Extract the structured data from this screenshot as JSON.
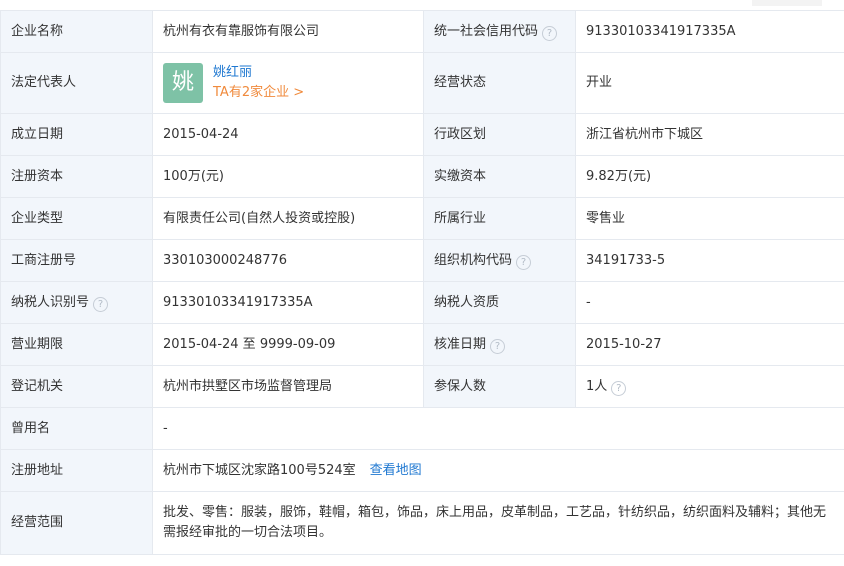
{
  "rows": [
    {
      "l1": "企业名称",
      "v1": "杭州有衣有靠服饰有限公司",
      "l2": "统一社会信用代码",
      "v2": "91330103341917335A"
    },
    {
      "l1": "法定代表人",
      "l2": "经营状态",
      "v2": "开业"
    },
    {
      "l1": "成立日期",
      "v1": "2015-04-24",
      "l2": "行政区划",
      "v2": "浙江省杭州市下城区"
    },
    {
      "l1": "注册资本",
      "v1": "100万(元)",
      "l2": "实缴资本",
      "v2": "9.82万(元)"
    },
    {
      "l1": "企业类型",
      "v1": "有限责任公司(自然人投资或控股)",
      "l2": "所属行业",
      "v2": "零售业"
    },
    {
      "l1": "工商注册号",
      "v1": "330103000248776",
      "l2": "组织机构代码",
      "v2": "34191733-5"
    },
    {
      "l1": "纳税人识别号",
      "v1": "91330103341917335A",
      "l2": "纳税人资质",
      "v2": "-"
    },
    {
      "l1": "营业期限",
      "v1": "2015-04-24 至 9999-09-09",
      "l2": "核准日期",
      "v2": "2015-10-27"
    },
    {
      "l1": "登记机关",
      "v1": "杭州市拱墅区市场监督管理局",
      "l2": "参保人数",
      "v2": "1人"
    },
    {
      "l1": "曾用名",
      "v1": "-"
    },
    {
      "l1": "注册地址",
      "v1": "杭州市下城区沈家路100号524室",
      "link": "查看地图"
    },
    {
      "l1": "经营范围",
      "v1": "批发、零售：服装，服饰，鞋帽，箱包，饰品，床上用品，皮革制品，工艺品，针纺织品，纺织面料及辅料；其他无需报经审批的一切合法项目。"
    }
  ],
  "representative": {
    "avatar_char": "姚",
    "name": "姚红丽",
    "link": "TA有2家企业 >",
    "avatar_color": "#7ec2a6"
  },
  "help_icon_glyph": "?",
  "colors": {
    "label_bg": "#f2f6fb",
    "border": "#e5e9ef",
    "link_blue": "#1f78d1",
    "link_orange": "#f08a3c"
  }
}
